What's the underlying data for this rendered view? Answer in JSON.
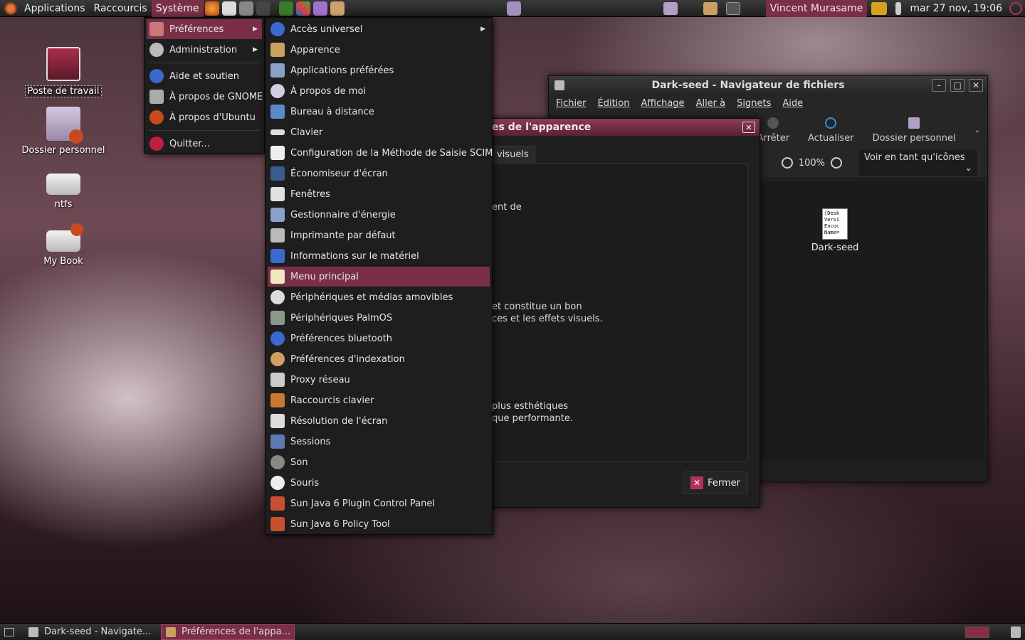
{
  "top_panel": {
    "menus": [
      "Applications",
      "Raccourcis",
      "Système"
    ],
    "user": "Vincent Murasame",
    "clock": "mar 27 nov, 19:06"
  },
  "desktop": {
    "icons": [
      {
        "label": "Poste de travail"
      },
      {
        "label": "Dossier personnel"
      },
      {
        "label": "ntfs"
      },
      {
        "label": "My Book"
      }
    ]
  },
  "system_menu": {
    "items": [
      {
        "label": "Préférences",
        "submenu": true
      },
      {
        "label": "Administration",
        "submenu": true
      },
      {
        "label": "Aide et soutien"
      },
      {
        "label": "À propos de GNOME"
      },
      {
        "label": "À propos d'Ubuntu"
      },
      {
        "label": "Quitter..."
      }
    ]
  },
  "prefs_menu": {
    "items": [
      {
        "label": "Accès universel",
        "submenu": true
      },
      {
        "label": "Apparence"
      },
      {
        "label": "Applications préférées"
      },
      {
        "label": "À propos de moi"
      },
      {
        "label": "Bureau à distance"
      },
      {
        "label": "Clavier"
      },
      {
        "label": "Configuration de la Méthode de Saisie SCIM"
      },
      {
        "label": "Économiseur d'écran"
      },
      {
        "label": "Fenêtres"
      },
      {
        "label": "Gestionnaire d'énergie"
      },
      {
        "label": "Imprimante par défaut"
      },
      {
        "label": "Informations sur le matériel"
      },
      {
        "label": "Menu principal",
        "highlighted": true
      },
      {
        "label": "Périphériques et médias amovibles"
      },
      {
        "label": "Périphériques PalmOS"
      },
      {
        "label": "Préférences bluetooth"
      },
      {
        "label": "Préférences d'indexation"
      },
      {
        "label": "Proxy réseau"
      },
      {
        "label": "Raccourcis clavier"
      },
      {
        "label": "Résolution de l'écran"
      },
      {
        "label": "Sessions"
      },
      {
        "label": "Son"
      },
      {
        "label": "Souris"
      },
      {
        "label": "Sun Java 6 Plugin Control Panel"
      },
      {
        "label": "Sun Java 6 Policy Tool"
      }
    ]
  },
  "file_manager": {
    "title": "Dark-seed - Navigateur de fichiers",
    "menubar": [
      "Fichier",
      "Édition",
      "Affichage",
      "Aller à",
      "Signets",
      "Aide"
    ],
    "toolbar": {
      "stop": "Arrêter",
      "reload": "Actualiser",
      "home": "Dossier personnel"
    },
    "zoom": "100%",
    "view_mode": "Voir en tant qu'icônes",
    "file": {
      "name": "Dark-seed",
      "preview_lines": [
        "[Desk",
        "Versi",
        "Encoc",
        "Name="
      ]
    }
  },
  "appearance_dialog": {
    "title_fragment": "es de l'apparence",
    "tab_fragment": "visuels",
    "text_1": "ent de",
    "text_2a": "et constitue un bon",
    "text_2b": "ces et les effets visuels.",
    "text_3a": "plus esthétiques",
    "text_3b": "que performante.",
    "close_label": "Fermer"
  },
  "bottom_panel": {
    "tasks": [
      "Dark-seed - Navigate...",
      "Préférences de l'appa..."
    ]
  },
  "colors": {
    "accent": "#7a2f46",
    "panel": "#262626"
  }
}
